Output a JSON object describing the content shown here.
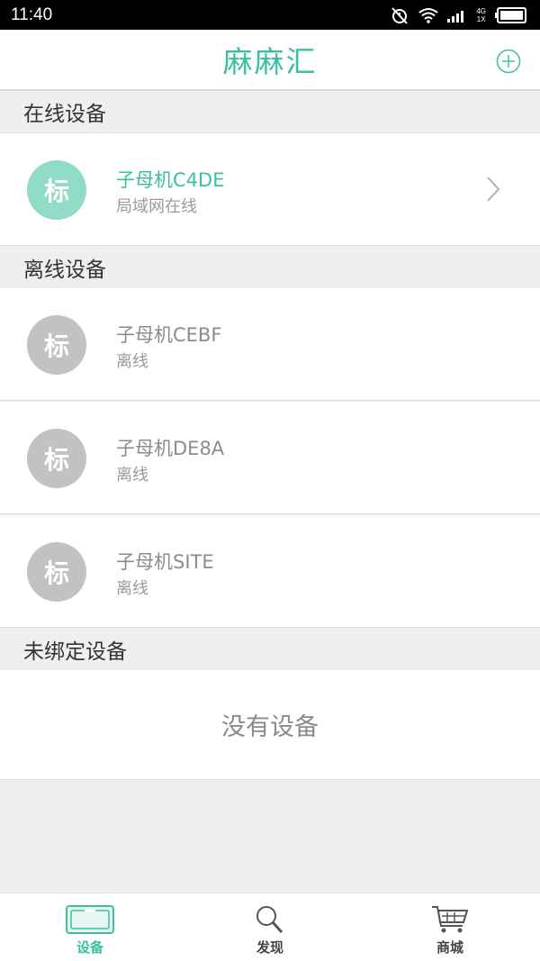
{
  "status_bar": {
    "time": "11:40",
    "network_top": "4G",
    "network_bottom": "1X"
  },
  "header": {
    "title": "麻麻汇",
    "add_icon": "plus-circle-icon"
  },
  "sections": {
    "online": {
      "title": "在线设备",
      "devices": [
        {
          "avatar_text": "标",
          "name": "子母机C4DE",
          "status": "局域网在线"
        }
      ]
    },
    "offline": {
      "title": "离线设备",
      "devices": [
        {
          "avatar_text": "标",
          "name": "子母机CEBF",
          "status": "离线"
        },
        {
          "avatar_text": "标",
          "name": "子母机DE8A",
          "status": "离线"
        },
        {
          "avatar_text": "标",
          "name": "子母机SITE",
          "status": "离线"
        }
      ]
    },
    "unbound": {
      "title": "未绑定设备",
      "empty_text": "没有设备"
    }
  },
  "tabs": [
    {
      "label": "设备",
      "icon": "device-icon",
      "active": true
    },
    {
      "label": "发现",
      "icon": "search-icon",
      "active": false
    },
    {
      "label": "商城",
      "icon": "cart-icon",
      "active": false
    }
  ],
  "colors": {
    "accent": "#3cc1a0",
    "online_avatar": "#90dcc6",
    "offline_avatar": "#c2c2c2"
  }
}
